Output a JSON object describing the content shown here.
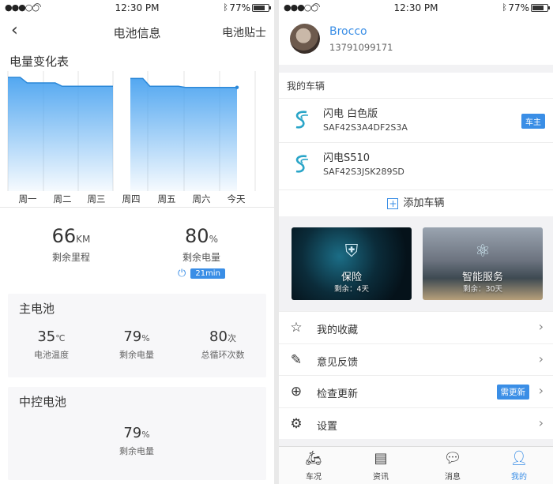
{
  "status": {
    "time": "12:30 PM",
    "battery": "77%"
  },
  "left": {
    "nav": {
      "title": "电池信息",
      "right_label": "电池贴士"
    },
    "chart_title": "电量变化表",
    "chart_data": {
      "type": "area",
      "categories": [
        "周一",
        "周二",
        "周三",
        "周四",
        "周五",
        "周六",
        "今天"
      ],
      "series": [
        {
          "values": [
            93,
            88,
            85,
            85
          ]
        },
        {
          "values": [
            null,
            null,
            null,
            92,
            85,
            84,
            84
          ]
        }
      ],
      "ylim": [
        0,
        100
      ],
      "color": "#4aa3f0"
    },
    "summary": {
      "range_value": "66",
      "range_unit": "KM",
      "range_label": "剩余里程",
      "charge_value": "80",
      "charge_unit": "%",
      "charge_label": "剩余电量",
      "charge_time": "21min"
    },
    "main_battery": {
      "title": "主电池",
      "temp_value": "35",
      "temp_unit": "℃",
      "temp_label": "电池温度",
      "charge_value": "79",
      "charge_unit": "%",
      "charge_label": "剩余电量",
      "cycles_value": "80",
      "cycles_unit": "次",
      "cycles_label": "总循环次数"
    },
    "control_battery": {
      "title": "中控电池",
      "charge_value": "79",
      "charge_unit": "%",
      "charge_label": "剩余电量"
    }
  },
  "right": {
    "profile": {
      "name": "Brocco",
      "phone": "13791099171"
    },
    "vehicles_label": "我的车辆",
    "vehicles": [
      {
        "name": "闪电  白色版",
        "id": "SAF42S3A4DF2S3A",
        "badge": "车主"
      },
      {
        "name": "闪电S510",
        "id": "SAF42S3JSK289SD"
      }
    ],
    "add_vehicle": "添加车辆",
    "services": [
      {
        "title": "保险",
        "sub": "剩余：4天"
      },
      {
        "title": "智能服务",
        "sub": "剩余：30天"
      }
    ],
    "menu": [
      {
        "label": "我的收藏"
      },
      {
        "label": "意见反馈"
      },
      {
        "label": "检查更新",
        "badge": "需更新"
      },
      {
        "label": "设置"
      }
    ],
    "tabs": [
      {
        "label": "车况"
      },
      {
        "label": "资讯"
      },
      {
        "label": "消息"
      },
      {
        "label": "我的"
      }
    ]
  }
}
